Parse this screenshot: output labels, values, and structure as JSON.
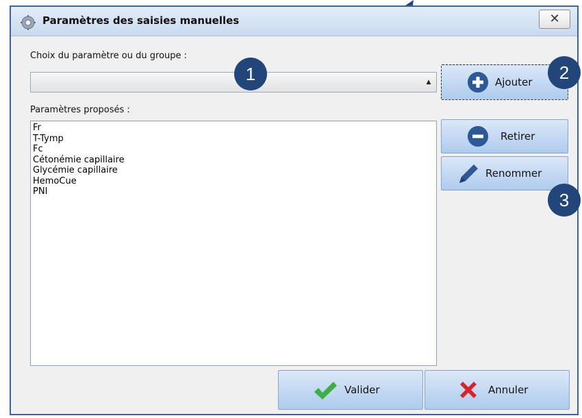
{
  "window": {
    "title": "Paramètres des saisies manuelles",
    "close_label": "✕"
  },
  "choice": {
    "label": "Choix du paramètre ou du groupe :",
    "value": ""
  },
  "proposed": {
    "label": "Paramètres proposés :",
    "items": [
      "Fr",
      "T-Tymp",
      "Fc",
      "Cétonémie capillaire",
      "Glycémie capillaire",
      "HemoCue",
      "PNI"
    ]
  },
  "buttons": {
    "add": "Ajouter",
    "remove": "Retirer",
    "rename": "Renommer",
    "ok": "Valider",
    "cancel": "Annuler"
  },
  "annotations": {
    "one": "1",
    "two": "2",
    "three": "3"
  },
  "colors": {
    "badge": "#21477a",
    "icon": "#2e5996",
    "ok_check": "#3fae49",
    "cancel_x": "#d9232a"
  },
  "icons": {
    "add": "plus-circle-icon",
    "remove": "minus-circle-icon",
    "rename": "pencil-icon",
    "ok": "check-icon",
    "cancel": "x-icon",
    "window": "gear-icon"
  }
}
